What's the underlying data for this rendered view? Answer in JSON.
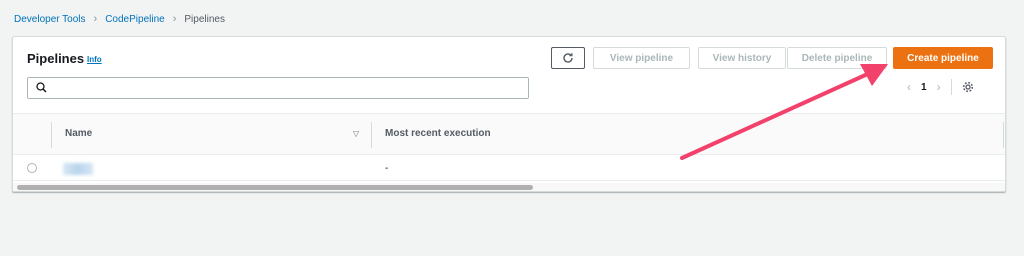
{
  "breadcrumb": {
    "items": [
      "Developer Tools",
      "CodePipeline"
    ],
    "current": "Pipelines"
  },
  "panel": {
    "title": "Pipelines",
    "info_label": "Info"
  },
  "actions": {
    "refresh_icon": "refresh-icon",
    "view_pipeline": "View pipeline",
    "view_history": "View history",
    "delete_pipeline": "Delete pipeline",
    "create_pipeline": "Create pipeline"
  },
  "search": {
    "value": "",
    "placeholder": ""
  },
  "pagination": {
    "current_page": "1"
  },
  "table": {
    "columns": [
      "Name",
      "Most recent execution"
    ],
    "rows": [
      {
        "name": "",
        "most_recent_execution": "-"
      }
    ]
  },
  "colors": {
    "primary_button": "#ec7211",
    "link": "#0073bb",
    "annotation_arrow": "#f2416b"
  }
}
